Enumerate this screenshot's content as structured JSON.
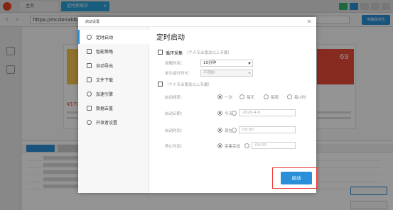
{
  "browser": {
    "tabs": [
      "主页",
      "定时抓取中"
    ],
    "url": "https://mcdonalds",
    "top_right_button": "电脑端浏览"
  },
  "webpage": {
    "prices": [
      "¥170.00",
      "69"
    ]
  },
  "dialog": {
    "title": "启动设置",
    "close_icon": "×",
    "nav": [
      {
        "label": "定时启动",
        "icon": "clock-icon"
      },
      {
        "label": "智能策略",
        "icon": "strategy-icon"
      },
      {
        "label": "自动导出",
        "icon": "export-icon"
      },
      {
        "label": "文件下载",
        "icon": "download-icon"
      },
      {
        "label": "加速引擎",
        "icon": "rocket-icon"
      },
      {
        "label": "数据去重",
        "icon": "dedupe-icon"
      },
      {
        "label": "开发者设置",
        "icon": "dev-icon"
      }
    ],
    "section_title": "定时启动",
    "loop": {
      "label": "循环采集",
      "note": "（个人专业版及以上专属）",
      "interval_label": "间隔时间：",
      "interval_value": "10分钟",
      "runtime_label": "单次运行时长：",
      "runtime_value": "不限制"
    },
    "schedule": {
      "note": "（个人专业版及以上专属）",
      "freq_label": "启动频率：",
      "freq_options": [
        "一次",
        "每天",
        "每周",
        "每小时"
      ],
      "date_label": "启动日期：",
      "date_today": "今天",
      "date_value": "2020-4-6",
      "time_label": "启动时间：",
      "time_now": "现在",
      "time_value": "00:00",
      "stop_label": "停止时间：",
      "stop_option": "采集完成",
      "stop_value": "00:00"
    },
    "start_button": "启动"
  }
}
